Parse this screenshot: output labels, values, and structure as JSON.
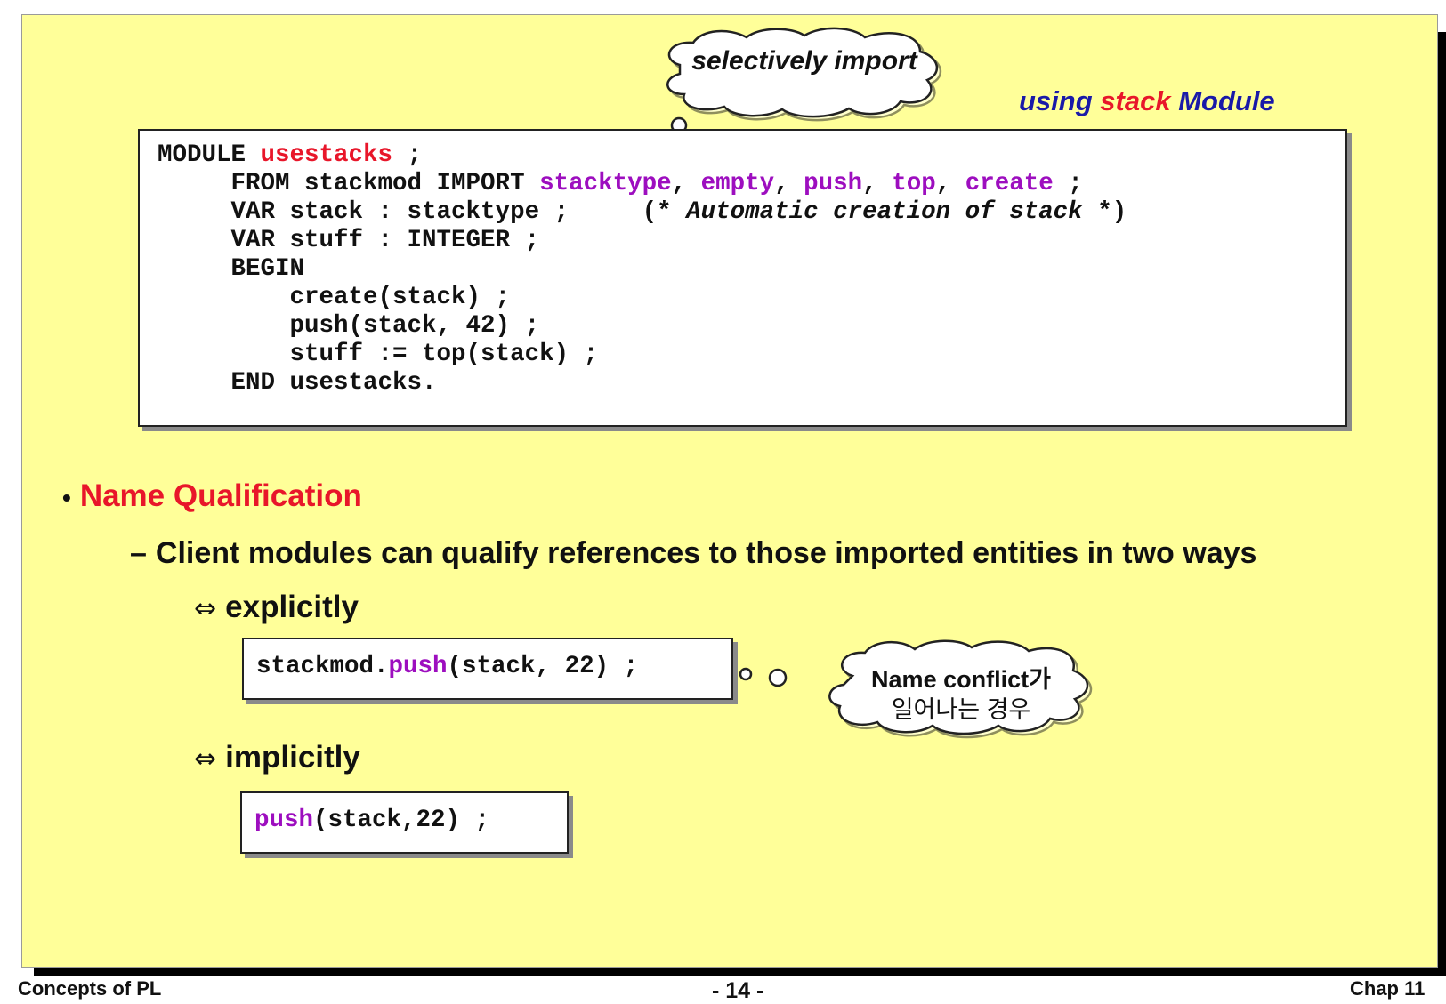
{
  "header": {
    "title_parts": [
      {
        "text": "using ",
        "color": "#1a1aa8"
      },
      {
        "text": "stack",
        "color": "#e8162a"
      },
      {
        "text": " Module",
        "color": "#1a1aa8"
      }
    ],
    "cloud_import": "selectively import"
  },
  "code_main": {
    "lines": [
      [
        {
          "t": "MODULE ",
          "c": ""
        },
        {
          "t": "usestacks",
          "c": "red"
        },
        {
          "t": " ;",
          "c": ""
        }
      ],
      [
        {
          "t": "     FROM stackmod IMPORT ",
          "c": ""
        },
        {
          "t": "stacktype",
          "c": "purple"
        },
        {
          "t": ", ",
          "c": ""
        },
        {
          "t": "empty",
          "c": "purple"
        },
        {
          "t": ", ",
          "c": ""
        },
        {
          "t": "push",
          "c": "purple"
        },
        {
          "t": ", ",
          "c": ""
        },
        {
          "t": "top",
          "c": "purple"
        },
        {
          "t": ", ",
          "c": ""
        },
        {
          "t": "create",
          "c": "purple"
        },
        {
          "t": " ;",
          "c": ""
        }
      ],
      [
        {
          "t": "     VAR stack : stacktype ;     ",
          "c": ""
        },
        {
          "t": "(* ",
          "c": ""
        },
        {
          "t": "Automatic creation of stack",
          "c": "italic"
        },
        {
          "t": " *)",
          "c": ""
        }
      ],
      [
        {
          "t": "     VAR stuff : INTEGER ;",
          "c": ""
        }
      ],
      [
        {
          "t": "     BEGIN",
          "c": ""
        }
      ],
      [
        {
          "t": "         create(stack) ;",
          "c": ""
        }
      ],
      [
        {
          "t": "         push(stack, 42) ;",
          "c": ""
        }
      ],
      [
        {
          "t": "         stuff := top(stack) ;",
          "c": ""
        }
      ],
      [
        {
          "t": "     END usestacks.",
          "c": ""
        }
      ]
    ]
  },
  "bullets": {
    "level1_marker": "•",
    "level1_text": "Name Qualification",
    "level2_marker": "–",
    "level2_text": "Client modules can qualify references to those imported entities in two ways",
    "level3_marker": "⇔",
    "explicit_label": "explicitly",
    "implicit_label": "implicitly"
  },
  "code_explicit": [
    {
      "t": "stackmod.",
      "c": ""
    },
    {
      "t": "push",
      "c": "purple"
    },
    {
      "t": "(stack, 22) ;",
      "c": ""
    }
  ],
  "code_implicit": [
    {
      "t": "push",
      "c": "purple"
    },
    {
      "t": "(stack,22) ;",
      "c": ""
    }
  ],
  "cloud_conflict": {
    "line1": "Name conflict가",
    "line2": "일어나는 경우"
  },
  "footer": {
    "left": "Concepts of PL",
    "center": "- 14 -",
    "right": "Chap 11"
  },
  "colors": {
    "slide_bg": "#ffff99",
    "keyword_red": "#e8162a",
    "keyword_purple": "#9d0ebf",
    "title_blue": "#1a1aa8"
  }
}
